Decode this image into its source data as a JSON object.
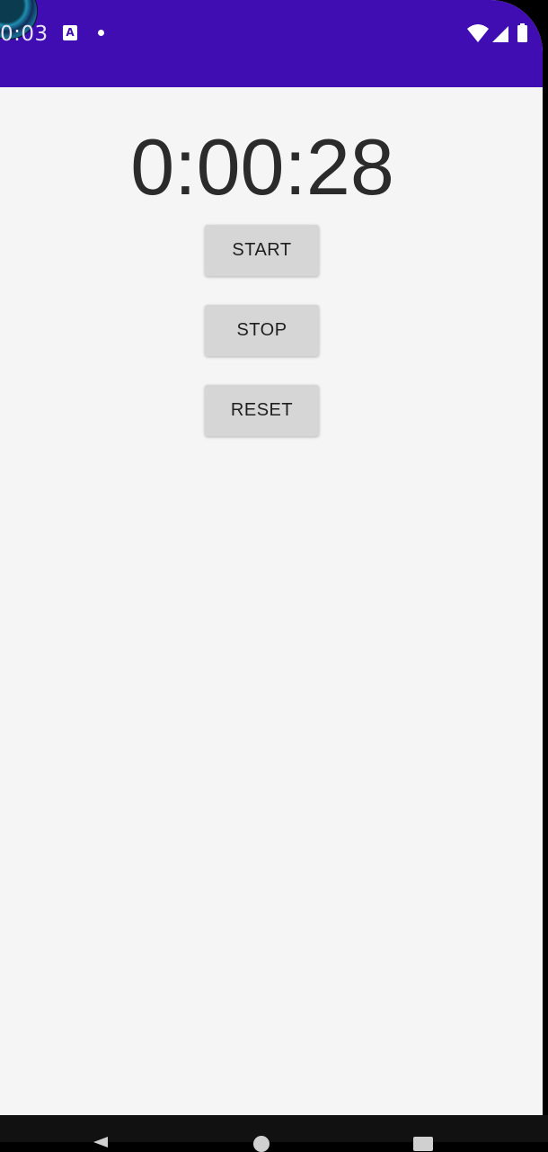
{
  "status_bar": {
    "time": "0:03",
    "background": "#3f0db1",
    "icons": [
      "camera-bubble-icon",
      "text-a-icon",
      "notification-dot-icon",
      "wifi-icon",
      "signal-icon",
      "battery-icon"
    ]
  },
  "stopwatch": {
    "display": "0:00:28"
  },
  "buttons": {
    "start_label": "START",
    "stop_label": "STOP",
    "reset_label": "RESET"
  },
  "nav_bar": {
    "icons": [
      "back-icon",
      "home-icon",
      "recents-icon"
    ]
  },
  "colors": {
    "app_bar": "#3f0db1",
    "background": "#f5f5f5",
    "button": "#d6d6d6",
    "text": "#2b2b2b"
  }
}
